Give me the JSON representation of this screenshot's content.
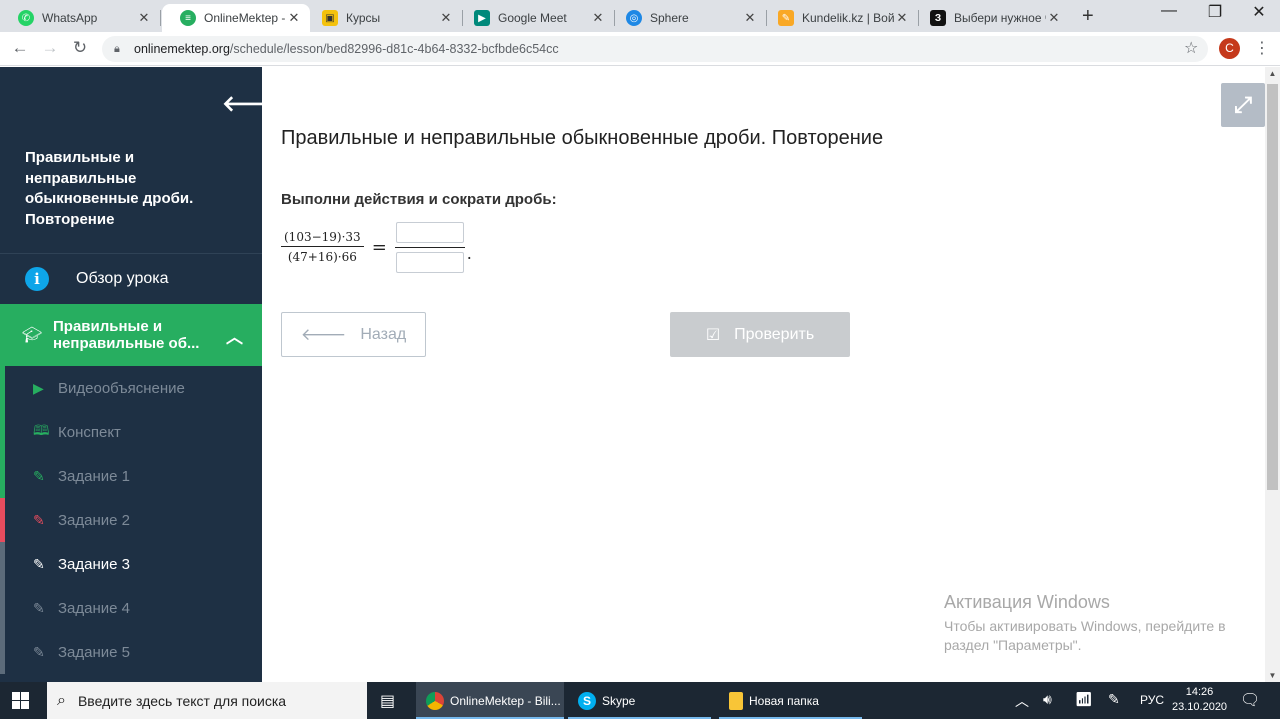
{
  "browser": {
    "tabs": [
      {
        "title": "WhatsApp",
        "icon": "whatsapp-icon",
        "color": "#25d366",
        "active": false
      },
      {
        "title": "OnlineMektep - Bi",
        "icon": "onlinemektep-icon",
        "color": "#27ae60",
        "active": true
      },
      {
        "title": "Курсы",
        "icon": "kursy-icon",
        "color": "#f4c20d",
        "active": false
      },
      {
        "title": "Google Meet",
        "icon": "google-meet-icon",
        "color": "#00897b",
        "active": false
      },
      {
        "title": "Sphere",
        "icon": "sphere-icon",
        "color": "#1e88e5",
        "active": false
      },
      {
        "title": "Kundelik.kz | Войт",
        "icon": "kundelik-icon",
        "color": "#f9a825",
        "active": false
      },
      {
        "title": "Выбери нужное ч",
        "icon": "yaklass-icon",
        "color": "#111111",
        "active": false
      }
    ],
    "new_tab": "+",
    "url_host": "onlinemektep.org",
    "url_path": "/schedule/lesson/bed82996-d81c-4b64-8332-bcfbde6c54cc",
    "profile_initial": "C",
    "profile_color": "#c5391b"
  },
  "sidebar": {
    "lesson_title": "Правильные и неправильные обыкновенные дроби. Повторение",
    "overview_label": "Обзор урока",
    "section_label": "Правильные и неправильные об...",
    "items": [
      {
        "label": "Видеообъяснение",
        "icon": "play-icon",
        "accent": "#27ae60"
      },
      {
        "label": "Конспект",
        "icon": "book-icon",
        "accent": "#27ae60"
      },
      {
        "label": "Задание 1",
        "icon": "edit-icon",
        "accent": "#27ae60"
      },
      {
        "label": "Задание 2",
        "icon": "edit-icon",
        "accent": "#e74c5e"
      },
      {
        "label": "Задание 3",
        "icon": "edit-icon",
        "accent": "#5c6b7a"
      },
      {
        "label": "Задание 4",
        "icon": "edit-icon",
        "accent": "#5c6b7a"
      },
      {
        "label": "Задание 5",
        "icon": "edit-icon",
        "accent": "#5c6b7a"
      }
    ]
  },
  "main": {
    "title": "Правильные и неправильные обыкновенные дроби. Повторение",
    "prompt": "Выполни действия и сократи дробь:",
    "numerator": "(103−19)·33",
    "denominator": "(47+16)·66",
    "equals": "=",
    "period": ".",
    "numerator_answer": "",
    "denominator_answer": "",
    "back_label": "Назад",
    "check_label": "Проверить",
    "watermark_title": "Активация Windows",
    "watermark_text": "Чтобы активировать Windows, перейдите в раздел \"Параметры\"."
  },
  "taskbar": {
    "search_placeholder": "Введите здесь текст для поиска",
    "apps": [
      {
        "label": "OnlineMektep - Bili...",
        "color": "#db4437",
        "active": true
      },
      {
        "label": "Skype",
        "color": "#00aff0",
        "active": false
      },
      {
        "label": "Новая папка",
        "color": "#f8c537",
        "active": false
      }
    ],
    "language": "РУС",
    "time": "14:26",
    "date": "23.10.2020"
  },
  "colors": {
    "sidebar_bg": "#1e3044",
    "section_green": "#27ae60",
    "check_disabled": "#c9cccf"
  }
}
